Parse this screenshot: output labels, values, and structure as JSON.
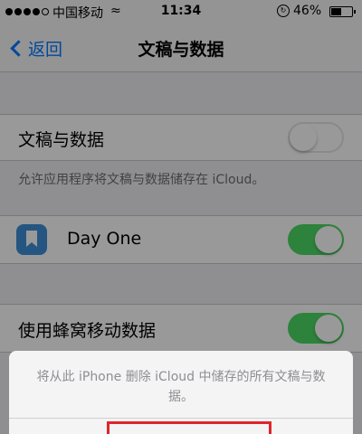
{
  "status_bar": {
    "carrier": "中国移动",
    "time": "11:34",
    "battery": "46%",
    "battery_level": 0.46
  },
  "nav": {
    "back_label": "返回",
    "title": "文稿与数据"
  },
  "settings": {
    "documents_label": "文稿与数据",
    "documents_enabled": false,
    "documents_footer": "允许应用程序将文稿与数据储存在 iCloud。",
    "day_one_label": "Day One",
    "day_one_enabled": true,
    "cellular_label": "使用蜂窝移动数据",
    "cellular_enabled": true
  },
  "action_sheet": {
    "message": "将从此 iPhone 删除 iCloud 中储存的所有文稿与数据。"
  },
  "colors": {
    "accent": "#007aff",
    "toggle_on": "#4cd964",
    "highlight": "#e0252a"
  }
}
